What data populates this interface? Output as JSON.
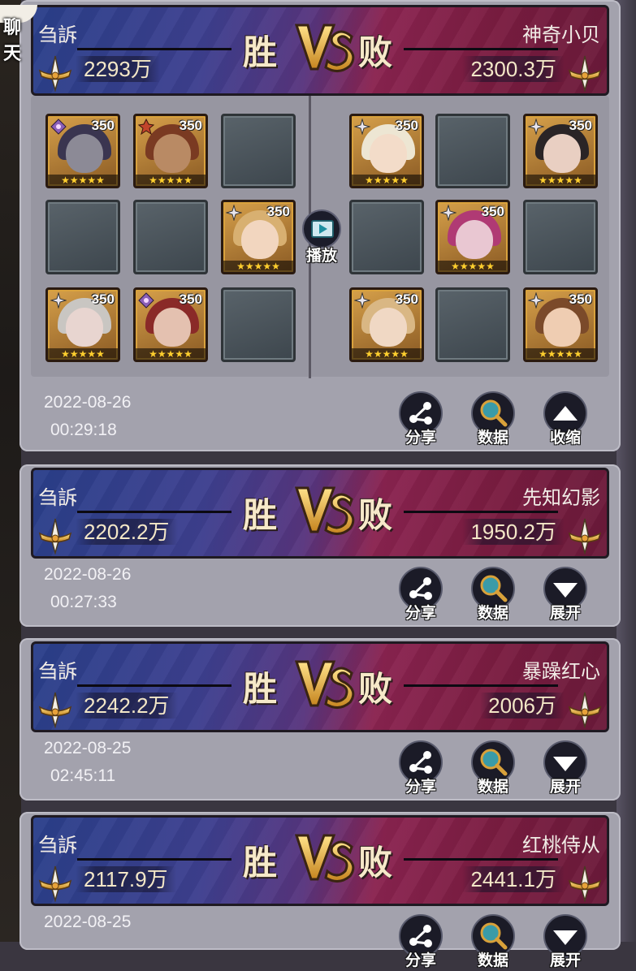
{
  "chat": {
    "label": "聊 天"
  },
  "actions": {
    "share": "分享",
    "data": "数据",
    "collapse": "收缩",
    "expand": "展开",
    "play": "播放"
  },
  "battles": [
    {
      "left_name": "刍訴",
      "left_power": "2293万",
      "right_name": "神奇小贝",
      "right_power": "2300.3万",
      "win_label": "胜",
      "lose_label": "败",
      "date": "2022-08-26",
      "time": "00:29:18",
      "expanded": true
    },
    {
      "left_name": "刍訴",
      "left_power": "2202.2万",
      "right_name": "先知幻影",
      "right_power": "1950.2万",
      "win_label": "胜",
      "lose_label": "败",
      "date": "2022-08-26",
      "time": "00:27:33",
      "expanded": false
    },
    {
      "left_name": "刍訴",
      "left_power": "2242.2万",
      "right_name": "暴躁红心",
      "right_power": "2006万",
      "win_label": "胜",
      "lose_label": "败",
      "date": "2022-08-25",
      "time": "02:45:11",
      "expanded": false
    },
    {
      "left_name": "刍訴",
      "left_power": "2117.9万",
      "right_name": "红桃侍从",
      "right_power": "2441.1万",
      "win_label": "胜",
      "lose_label": "败",
      "date": "2022-08-25",
      "expanded": false
    }
  ],
  "team_left": [
    {
      "filled": true,
      "level": "350",
      "stars": 5,
      "class_icon": "mage-icon",
      "hair": "#3a3550",
      "skin": "#8c8a96"
    },
    {
      "filled": true,
      "level": "350",
      "stars": 5,
      "class_icon": "warrior-icon",
      "hair": "#7a3a22",
      "skin": "#b98a64"
    },
    {
      "filled": false
    },
    {
      "filled": false
    },
    {
      "filled": false
    },
    {
      "filled": true,
      "level": "350",
      "stars": 5,
      "class_icon": "support-icon",
      "hair": "#d8b071",
      "skin": "#f2d6bf"
    },
    {
      "filled": true,
      "level": "350",
      "stars": 5,
      "class_icon": "support-icon",
      "hair": "#c9c6c2",
      "skin": "#e8d5d0"
    },
    {
      "filled": true,
      "level": "350",
      "stars": 5,
      "class_icon": "mage-icon",
      "hair": "#8a2a28",
      "skin": "#e4c1b0"
    },
    {
      "filled": false
    }
  ],
  "team_right": [
    {
      "filled": true,
      "level": "350",
      "stars": 5,
      "class_icon": "support-icon",
      "hair": "#ede6d3",
      "skin": "#f3dcc9"
    },
    {
      "filled": false
    },
    {
      "filled": true,
      "level": "350",
      "stars": 5,
      "class_icon": "support-icon",
      "hair": "#2a2426",
      "skin": "#e9cfc2"
    },
    {
      "filled": false
    },
    {
      "filled": true,
      "level": "350",
      "stars": 5,
      "class_icon": "support-icon",
      "hair": "#b03a74",
      "skin": "#e9c7d2"
    },
    {
      "filled": false
    },
    {
      "filled": true,
      "level": "350",
      "stars": 5,
      "class_icon": "support-icon",
      "hair": "#d9b784",
      "skin": "#f0d8c4"
    },
    {
      "filled": false
    },
    {
      "filled": true,
      "level": "350",
      "stars": 5,
      "class_icon": "support-icon",
      "hair": "#7b4a2a",
      "skin": "#efcdb2"
    }
  ],
  "colors": {
    "gold": "#f0b43a",
    "star": "#ffcf2e",
    "win_bg": "#2a3f8a",
    "lose_bg": "#7a1c40"
  }
}
